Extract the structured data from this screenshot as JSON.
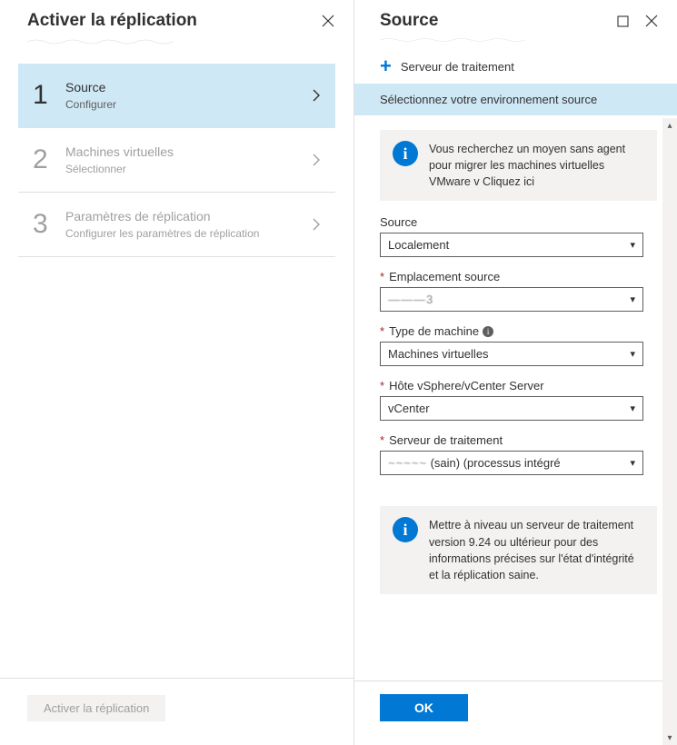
{
  "leftPanel": {
    "title": "Activer la réplication",
    "steps": [
      {
        "num": "1",
        "title": "Source",
        "subtitle": "Configurer",
        "active": true
      },
      {
        "num": "2",
        "title": "Machines virtuelles",
        "subtitle": "Sélectionner",
        "active": false
      },
      {
        "num": "3",
        "title": "Paramètres de réplication",
        "subtitle": "Configurer les paramètres de réplication",
        "active": false
      }
    ],
    "footerButton": "Activer la réplication"
  },
  "rightPanel": {
    "title": "Source",
    "commandBar": {
      "label": "Serveur de traitement"
    },
    "subhead": "Sélectionnez votre environnement source",
    "infoTop": "Vous recherchez un moyen sans agent pour migrer les machines virtuelles VMware v Cliquez ici",
    "fields": {
      "source": {
        "label": "Source",
        "value": "Localement",
        "required": false
      },
      "emplacement": {
        "label": "Emplacement source",
        "value": "———3",
        "required": true
      },
      "type": {
        "label": "Type de machine",
        "value": "Machines virtuelles",
        "required": true,
        "hasInfo": true
      },
      "hote": {
        "label": "Hôte vSphere/vCenter Server",
        "value": "vCenter",
        "required": true
      },
      "serveur": {
        "label": "Serveur de traitement",
        "value": "(sain) (processus intégré",
        "required": true
      }
    },
    "infoBottom": "Mettre à niveau un serveur de traitement version 9.24 ou ultérieur pour des informations précises sur l'état d'intégrité et la réplication saine.",
    "okButton": "OK"
  }
}
